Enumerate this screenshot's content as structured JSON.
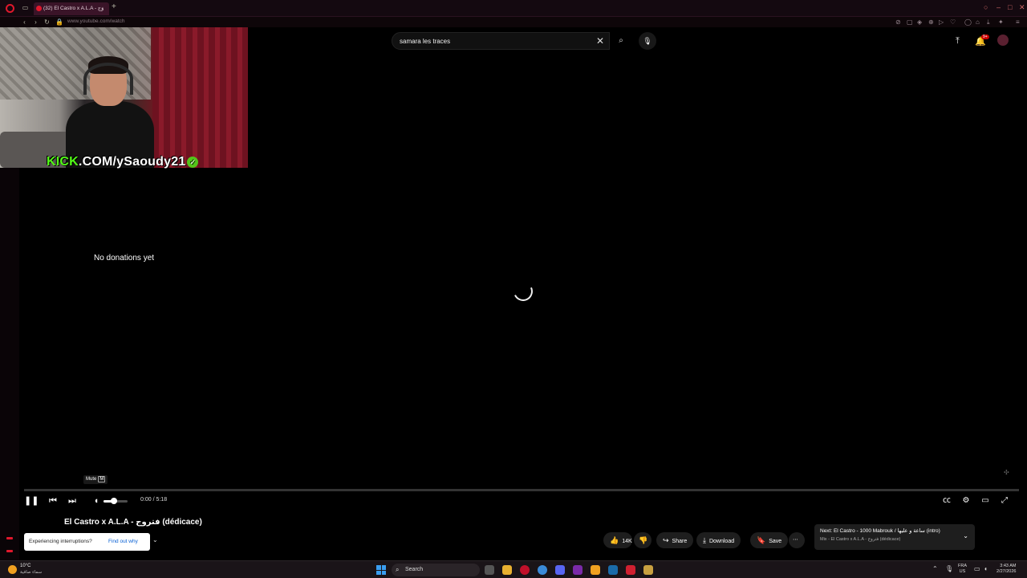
{
  "browser": {
    "tab_title": "(32) El Castro x A.L.A - وَج",
    "address": "www.youtube.com/watch"
  },
  "youtube": {
    "search_query": "samara les traces",
    "notification_count": "9+"
  },
  "overlay": {
    "kick_prefix": "KICK",
    "kick_rest": ".COM/ySaoudy21",
    "donations_text": "No donations yet"
  },
  "player": {
    "tooltip_label": "Mute",
    "tooltip_key": "M",
    "time": "0:00 / 5:18",
    "volume_level": 0.4,
    "progress": 0
  },
  "video": {
    "title": "El Castro x A.L.A - فتروج (dédicace)",
    "likes": "14K",
    "share_label": "Share",
    "download_label": "Download",
    "save_label": "Save"
  },
  "up_next": {
    "title": "Next: El Castro - 1000 Mabrouk / ساعة و عليها (intro)",
    "subtitle": "Mix - El Castro x A.L.A - فتروج (dédicace)"
  },
  "notice": {
    "text": "Experiencing interruptions?",
    "link": "Find out why"
  },
  "taskbar": {
    "temperature": "10°C",
    "weather_desc": "سماء صافية",
    "search_label": "Search",
    "lang_top": "FRA",
    "lang_bottom": "US",
    "clock_time": "3:43 AM",
    "clock_date": "2/27/2026"
  }
}
